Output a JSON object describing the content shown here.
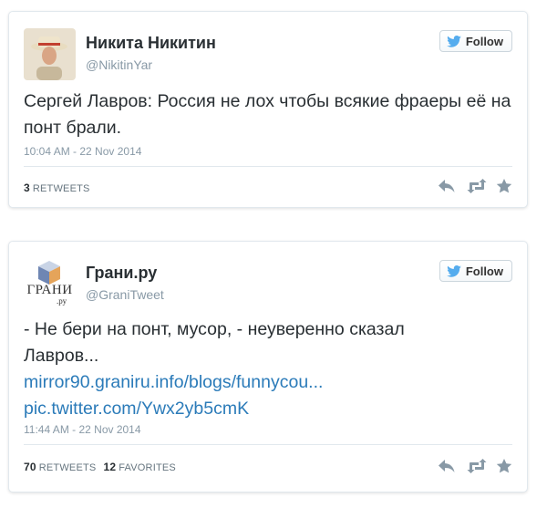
{
  "tweets": [
    {
      "name": "Никита Никитин",
      "handle": "@NikitinYar",
      "follow_label": "Follow",
      "text": "Сергей Лавров: Россия не лох чтобы всякие фраеры её на понт брали.",
      "timestamp": "10:04 AM - 22 Nov 2014",
      "retweets_count": "3",
      "retweets_label": "RETWEETS"
    },
    {
      "name": "Грани.ру",
      "handle": "@GraniTweet",
      "follow_label": "Follow",
      "text": "- Не бери на понт, мусор, - неуверенно сказал Лавров...",
      "link1": "mirror90.graniru.info/blogs/funnycou...",
      "link2": "pic.twitter.com/Ywx2yb5cmK",
      "timestamp": "11:44 AM - 22 Nov 2014",
      "retweets_count": "70",
      "retweets_label": "RETWEETS",
      "favorites_count": "12",
      "favorites_label": "FAVORITES",
      "avatar_text": "ГРАНИ",
      "avatar_sub": ".ру"
    }
  ],
  "icons": [
    "twitter-bird-icon",
    "reply-icon",
    "retweet-icon",
    "favorite-icon"
  ],
  "colors": {
    "link": "#2b7bb9",
    "muted": "#8899a6",
    "border": "#e1e8ed",
    "bird": "#55acee"
  }
}
